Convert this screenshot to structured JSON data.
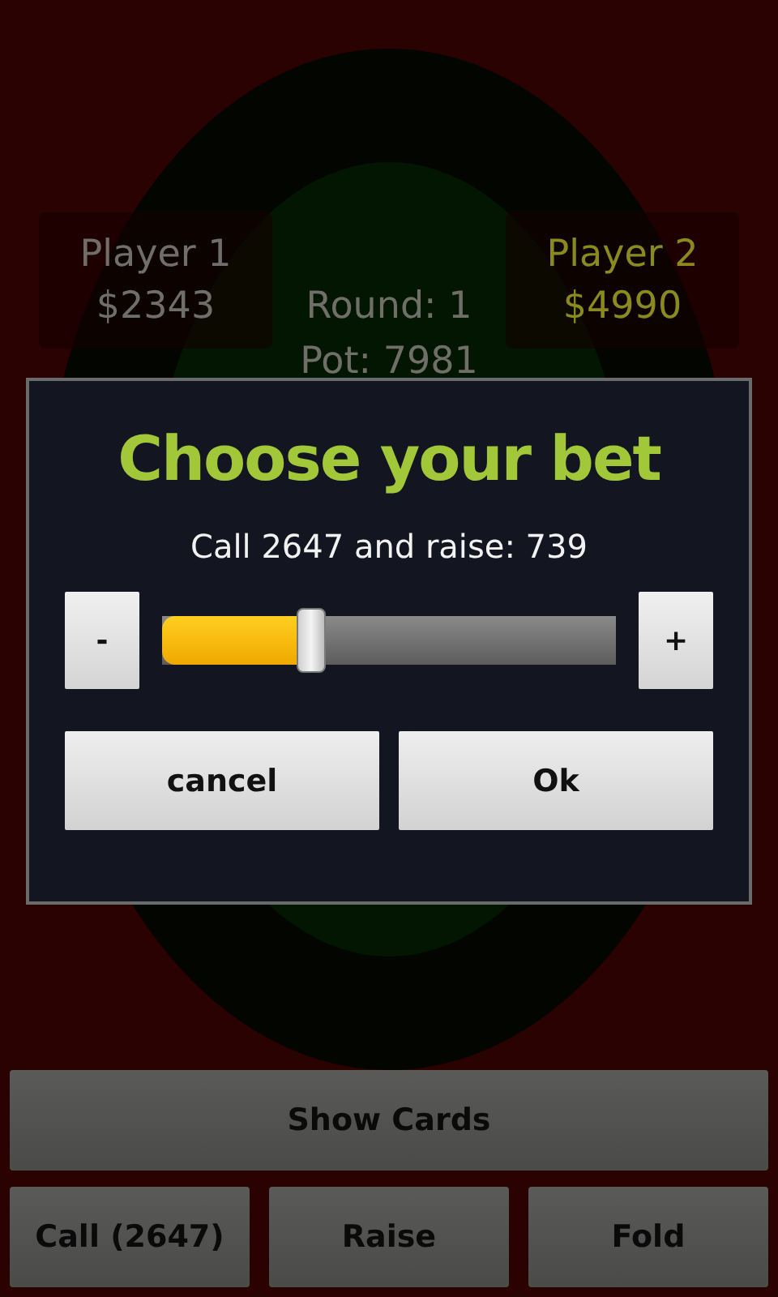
{
  "players": [
    {
      "name": "Player 1",
      "chips": "$2343",
      "active": false
    },
    {
      "name": "Player 2",
      "chips": "$4990",
      "active": true
    }
  ],
  "round": "Round: 1",
  "pot": "Pot: 7981",
  "actions": {
    "show_cards": "Show Cards",
    "buttons": [
      "Call (2647)",
      "Raise",
      "Fold"
    ]
  },
  "dialog": {
    "title": "Choose your bet",
    "message": "Call 2647 and raise: 739",
    "minus": "-",
    "plus": "+",
    "slider": {
      "level": 0.33
    },
    "buttons": [
      "cancel",
      "Ok"
    ]
  }
}
